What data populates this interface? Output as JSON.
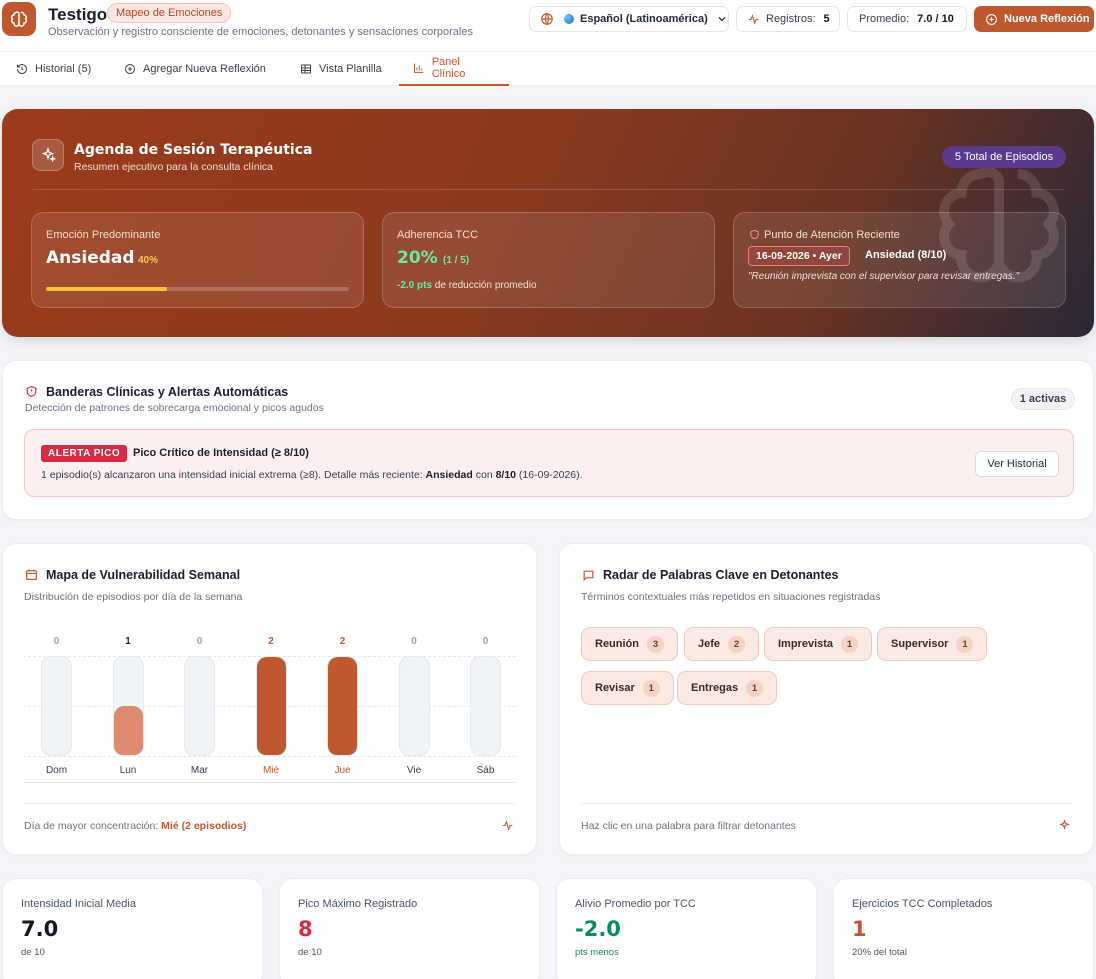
{
  "header": {
    "title": "Testigo",
    "pill": "Mapeo de Emociones",
    "subtitle": "Observación y registro consciente de emociones, detonantes y sensaciones corporales",
    "language": "Español (Latinoamérica)",
    "registros_label": "Registros:",
    "registros_value": "5",
    "promedio_label": "Promedio:",
    "promedio_value": "7.0 / 10",
    "new_button": "Nueva Reflexión"
  },
  "tabs": [
    {
      "label": "Historial (5)",
      "icon": "history-icon"
    },
    {
      "label": "Agregar Nueva Reflexión",
      "icon": "plus-circle-icon"
    },
    {
      "label": "Vista Planilla",
      "icon": "table-icon"
    },
    {
      "label": "Panel Clínico",
      "icon": "bar-chart-icon",
      "active": true
    }
  ],
  "hero": {
    "title": "Agenda de Sesión Terapéutica",
    "subtitle": "Resumen ejecutivo para la consulta clínica",
    "pill": "5 Total de Episodios",
    "card1": {
      "title": "Emoción Predominante",
      "value": "Ansiedad",
      "pct": "40%",
      "fraction": 0.4
    },
    "card2": {
      "title": "Adherencia TCC",
      "value": "20%",
      "frac": "(1 / 5)",
      "note_strong": "-2.0 pts",
      "note": " de reducción promedio"
    },
    "card3": {
      "title": "Punto de Atención Reciente",
      "date": "16-09-2026 • Ayer",
      "emotion": "Ansiedad (8/10)",
      "quote": "\"Reunión imprevista con el supervisor para revisar entregas.\""
    }
  },
  "alerts": {
    "title": "Banderas Clínicas y Alertas Automáticas",
    "subtitle": "Detección de patrones de sobrecarga emocional y picos agudos",
    "count": "1 activas",
    "badge": "ALERTA PICO",
    "alert_title": "Pico Crítico de Intensidad (≥ 8/10)",
    "text_a": "1 episodio(s) alcanzaron una intensidad inicial extrema (≥8). Detalle más reciente: ",
    "text_emotion": "Ansiedad",
    "text_b": " con ",
    "text_score": "8/10",
    "text_c": " (16-09-2026).",
    "button": "Ver Historial"
  },
  "week": {
    "title": "Mapa de Vulnerabilidad Semanal",
    "subtitle": "Distribución de episodios por día de la semana",
    "foot_label": "Día de mayor concentración: ",
    "foot_value": "Mié (2 episodios)"
  },
  "chart_data": {
    "type": "bar",
    "categories": [
      "Dom",
      "Lun",
      "Mar",
      "Mié",
      "Jue",
      "Vie",
      "Sáb"
    ],
    "values": [
      0,
      1,
      0,
      2,
      2,
      0,
      0
    ],
    "ylim": [
      0,
      2
    ],
    "grid": true,
    "colors": {
      "high": "#c0582f",
      "low": "#dd8a6e",
      "track": "#f1f4f7"
    }
  },
  "radar": {
    "title": "Radar de Palabras Clave en Detonantes",
    "subtitle": "Términos contextuales más repetidos en situaciones registradas",
    "keywords": [
      {
        "word": "Reunión",
        "count": "3"
      },
      {
        "word": "Jefe",
        "count": "2"
      },
      {
        "word": "Imprevista",
        "count": "1"
      },
      {
        "word": "Supervisor",
        "count": "1"
      },
      {
        "word": "Revisar",
        "count": "1"
      },
      {
        "word": "Entregas",
        "count": "1"
      }
    ],
    "foot": "Haz clic en una palabra para filtrar detonantes"
  },
  "stats": [
    {
      "title": "Intensidad Inicial Media",
      "value": "7.0",
      "unit": "de 10",
      "color": "#111827",
      "unit_color": "#4b5563"
    },
    {
      "title": "Pico Máximo Registrado",
      "value": "8",
      "unit": "de 10",
      "color": "#d72b45",
      "unit_color": "#4b5563"
    },
    {
      "title": "Alivio Promedio por TCC",
      "value": "-2.0",
      "unit": "pts menos",
      "color": "#0f8a5f",
      "unit_color": "#0f8a5f"
    },
    {
      "title": "Ejercicios TCC Completados",
      "value": "1",
      "unit": "20% del total",
      "color": "#c0582f",
      "unit_color": "#4b5563"
    }
  ],
  "colors": {
    "accent": "#c0582f",
    "alert": "#d72b45",
    "success": "#0f8a5f"
  }
}
